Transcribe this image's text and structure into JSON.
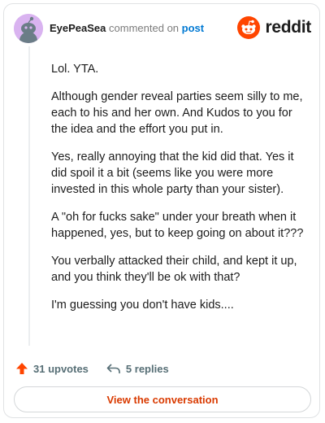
{
  "comment": {
    "username": "EyePeaSea",
    "action_text": "commented on",
    "post_link": "post",
    "paragraphs": [
      "Lol. YTA.",
      "Although gender reveal parties seem silly to me, each to his and her own. And Kudos to you for the idea and the effort you put in.",
      "Yes, really annoying that the kid did that. Yes it did spoil it a bit (seems like you were more invested in this whole party than your sister).",
      "A \"oh for fucks sake\" under your breath when it happened, yes, but to keep going on about it???",
      "You verbally attacked their child, and kept it up, and you think they'll be ok with that?",
      "I'm guessing you don't have kids...."
    ]
  },
  "brand": {
    "name": "reddit",
    "icon": "reddit-logo-icon",
    "color": "#ff4500"
  },
  "actions": {
    "upvotes": "31 upvotes",
    "replies": "5 replies"
  },
  "view_button": "View the conversation",
  "colors": {
    "accent": "#ff4500",
    "link": "#0079d3",
    "button_text": "#d93a00"
  }
}
